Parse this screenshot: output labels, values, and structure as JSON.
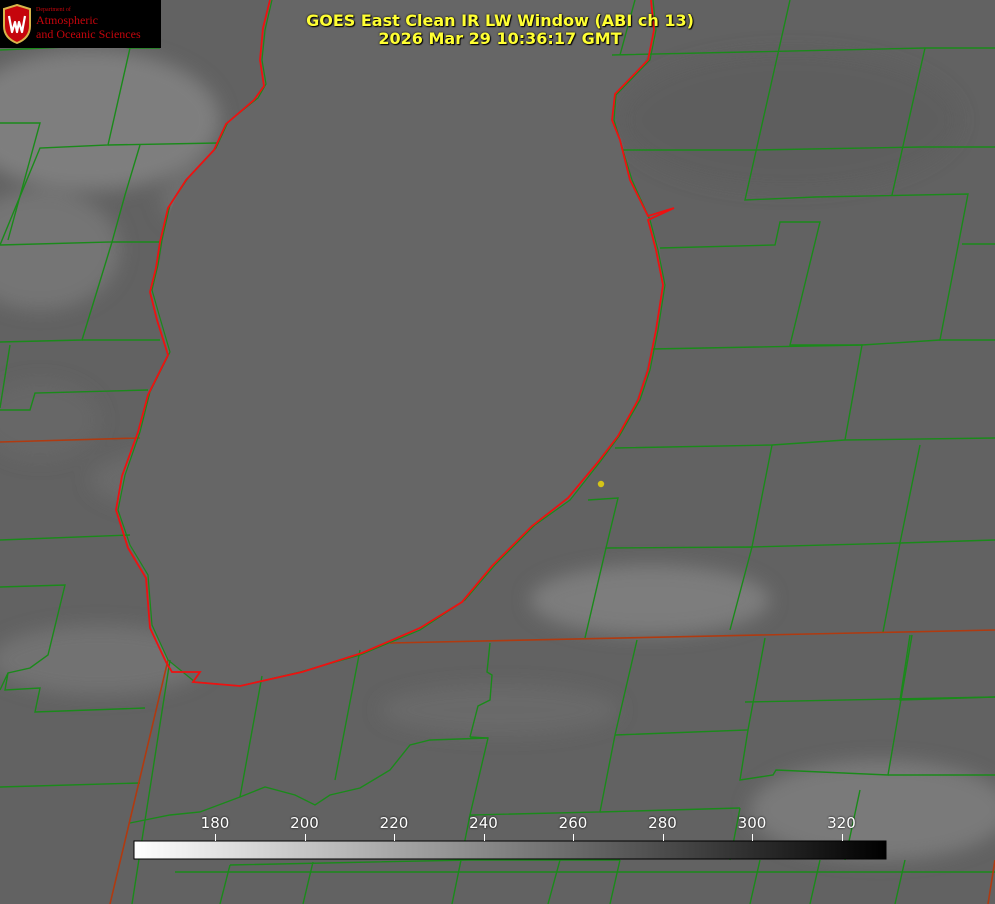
{
  "title": {
    "line1": "GOES East Clean IR LW Window (ABI ch 13)",
    "line2": "2026 Mar 29 10:36:17 GMT"
  },
  "logo": {
    "dept": "Department of",
    "line1": "Atmospheric",
    "line2": "and Oceanic Sciences",
    "icon": "uw-crest-icon",
    "color": "#c5050c"
  },
  "colorbar": {
    "ticks": [
      "180",
      "200",
      "220",
      "240",
      "260",
      "280",
      "300",
      "320"
    ],
    "gradient_start": "#ffffff",
    "gradient_end": "#000000"
  },
  "colors": {
    "county_lines": "#1a8a1a",
    "state_lines": "#b03a10",
    "lake_outline": "#ee1111",
    "title": "#ffff33",
    "station_dot": "#d4c417"
  }
}
